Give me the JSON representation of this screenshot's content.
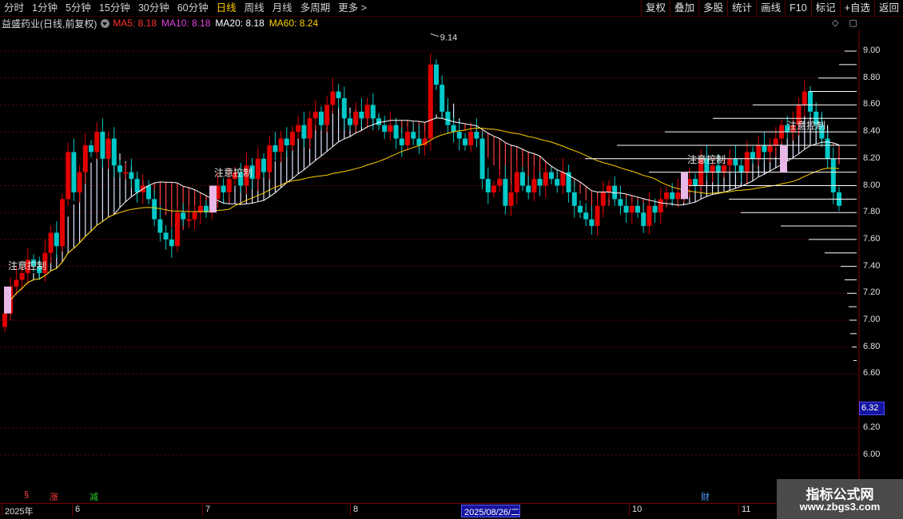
{
  "toolbar": {
    "periods": [
      "分时",
      "1分钟",
      "5分钟",
      "15分钟",
      "30分钟",
      "60分钟",
      "日线",
      "周线",
      "月线",
      "多周期",
      "更多 >"
    ],
    "active_period": "日线",
    "tools": [
      "复权",
      "叠加",
      "多股",
      "统计",
      "画线",
      "F10",
      "标记",
      "+自选",
      "返回"
    ]
  },
  "stock": {
    "name": "益盛药业(日线,前复权)",
    "ma5": "MA5: 8.18",
    "ma10": "MA10: 8.18",
    "ma20": "MA20: 8.18",
    "ma60": "MA60: 8.24",
    "ma5_color": "#ff3030",
    "ma10_color": "#e040e0",
    "ma20_color": "#ffffff",
    "ma60_color": "#ffd000"
  },
  "side_icons": [
    "◇",
    "▢"
  ],
  "chart": {
    "high_label": "9.14",
    "current_price": "6.32",
    "y_ticks": [
      "9.00",
      "8.80",
      "8.60",
      "8.40",
      "8.20",
      "8.00",
      "7.80",
      "7.60",
      "7.40",
      "7.20",
      "7.00",
      "6.80",
      "6.60",
      "6.20",
      "6.00"
    ],
    "annotation_text": "注意控制",
    "up_color": "#e00000",
    "down_color": "#00c8c8",
    "band_color": "#dde4ff"
  },
  "events": [
    "§",
    "涨",
    "减",
    "财"
  ],
  "date_axis": [
    "2025年",
    "6",
    "7",
    "8",
    "2025/08/26/二",
    "10",
    "11"
  ],
  "watermark": {
    "line1": "指标公式网",
    "line2": "www.zbgs3.com"
  },
  "chart_data": {
    "type": "candlestick",
    "y_axis_ticks": [
      6.0,
      6.2,
      6.6,
      6.8,
      7.0,
      7.2,
      7.4,
      7.6,
      7.8,
      8.0,
      8.2,
      8.4,
      8.6,
      8.8,
      9.0
    ],
    "period_high": 9.14,
    "current_price": 6.32,
    "closes": [
      7.05,
      7.25,
      7.3,
      7.35,
      7.45,
      7.4,
      7.35,
      7.5,
      7.65,
      7.55,
      7.9,
      8.25,
      7.95,
      8.1,
      8.3,
      8.25,
      8.4,
      8.2,
      8.35,
      8.15,
      8.1,
      8.1,
      8.05,
      7.95,
      8.0,
      7.9,
      7.75,
      7.65,
      7.6,
      7.55,
      7.8,
      7.75,
      7.75,
      7.8,
      7.85,
      7.8,
      7.9,
      8.0,
      7.95,
      8.05,
      8.1,
      8.0,
      8.15,
      8.05,
      8.2,
      8.1,
      8.3,
      8.25,
      8.35,
      8.3,
      8.4,
      8.45,
      8.35,
      8.5,
      8.55,
      8.45,
      8.6,
      8.7,
      8.65,
      8.5,
      8.45,
      8.55,
      8.5,
      8.6,
      8.5,
      8.45,
      8.4,
      8.45,
      8.35,
      8.3,
      8.4,
      8.35,
      8.3,
      8.35,
      8.9,
      8.75,
      8.55,
      8.45,
      8.4,
      8.35,
      8.3,
      8.4,
      8.35,
      8.05,
      7.95,
      8.0,
      8.05,
      7.85,
      7.95,
      8.1,
      8.0,
      7.95,
      8.05,
      8.0,
      8.1,
      8.05,
      8.0,
      8.1,
      7.95,
      7.85,
      7.8,
      7.75,
      7.7,
      7.85,
      7.95,
      8.0,
      7.9,
      7.85,
      7.8,
      7.85,
      7.8,
      7.7,
      7.85,
      7.8,
      7.9,
      7.95,
      7.9,
      7.95,
      8.0,
      8.05,
      8.0,
      8.2,
      8.1,
      8.15,
      8.1,
      8.15,
      8.2,
      8.15,
      8.1,
      8.25,
      8.2,
      8.3,
      8.25,
      8.3,
      8.35,
      8.45,
      8.4,
      8.45,
      8.6,
      8.7,
      8.55,
      8.45,
      8.35,
      8.2,
      7.95,
      7.85
    ],
    "ma60_curve": "yellow, rising from ~7.75 to ~8.35 then easing to ~7.90 then rising to ~8.15"
  }
}
